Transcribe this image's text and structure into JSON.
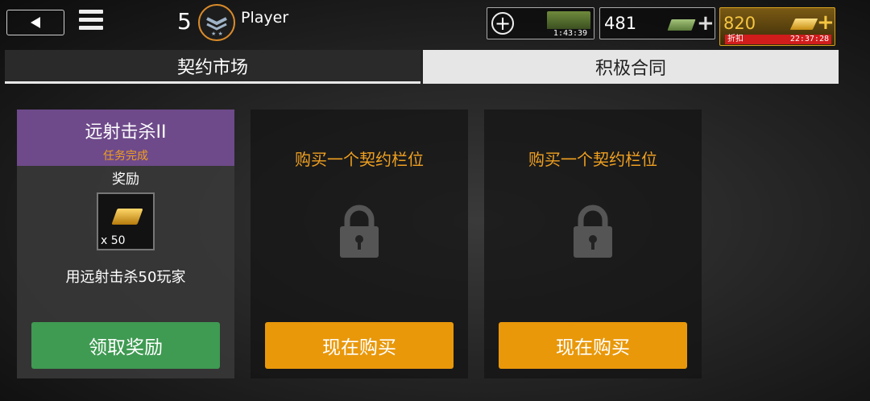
{
  "header": {
    "player_level": "5",
    "player_name": "Player",
    "energy_timer": "1:43:39",
    "cash_value": "481",
    "gold_value": "820",
    "discount_label": "折扣",
    "discount_timer": "22:37:28"
  },
  "tabs": [
    {
      "label": "契约市场",
      "active": false
    },
    {
      "label": "积极合同",
      "active": true
    }
  ],
  "claim_card": {
    "title": "远射击杀II",
    "status": "任务完成",
    "reward_label": "奖励",
    "reward_quantity": "x 50",
    "description": "用远射击杀50玩家",
    "button_label": "领取奖励"
  },
  "slot_cards": [
    {
      "title": "购买一个契约栏位",
      "button_label": "现在购买"
    },
    {
      "title": "购买一个契约栏位",
      "button_label": "现在购买"
    }
  ],
  "colors": {
    "accent_orange": "#e9980a",
    "claim_green": "#3f9a52",
    "header_purple": "#6e4a8a",
    "status_orange": "#f0a020",
    "discount_red": "#d11c1c"
  },
  "icons": [
    "back-arrow-icon",
    "menu-icon",
    "rank-chevron-icon",
    "add-icon",
    "supply-crate-icon",
    "cash-icon",
    "gold-bar-icon",
    "lock-icon"
  ]
}
